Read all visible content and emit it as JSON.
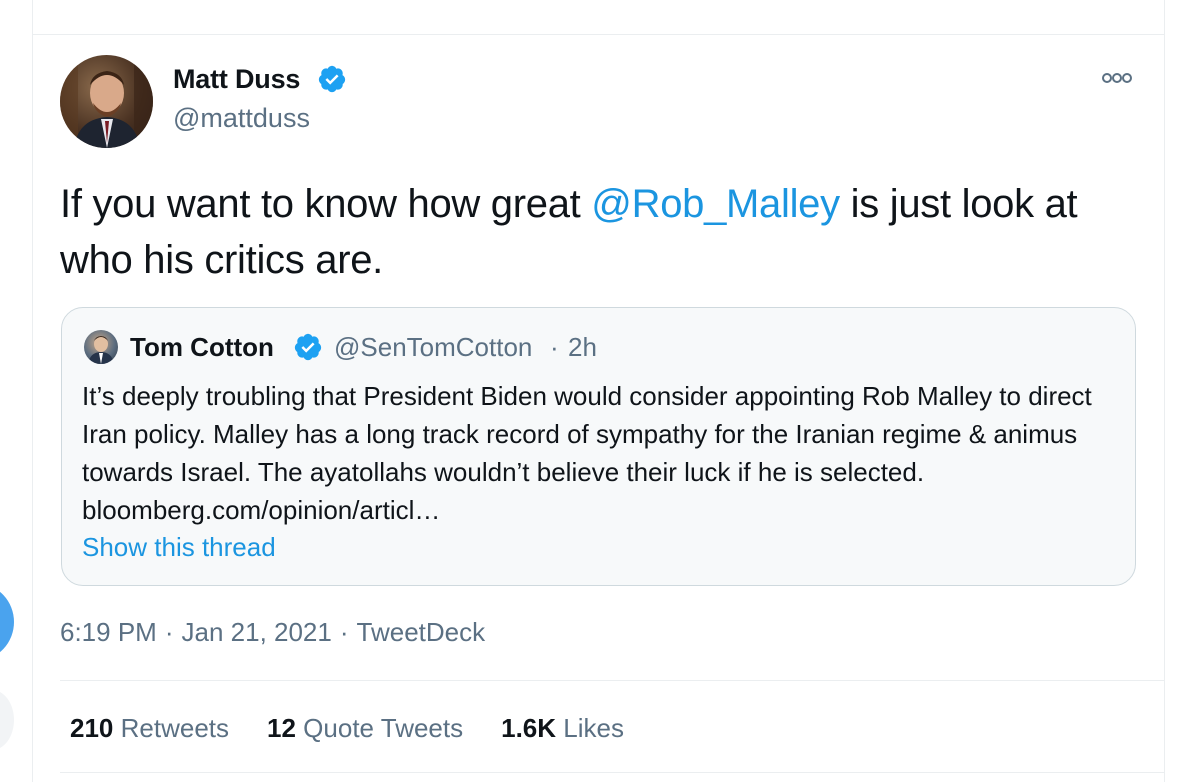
{
  "tweet": {
    "author": {
      "display_name": "Matt Duss",
      "handle": "@mattduss",
      "verified": true
    },
    "text_before": "If you want to know how great ",
    "mention": "@Rob_Malley",
    "text_after": " is just look at who his critics are.",
    "more_icon": "more-horizontal-icon",
    "quoted": {
      "author": {
        "display_name": "Tom Cotton",
        "handle": "@SenTomCotton",
        "verified": true
      },
      "separator": "·",
      "time": "2h",
      "text": "It’s deeply troubling that President Biden would consider appointing Rob Malley to direct Iran policy. Malley has a long track record of sympathy for the Iranian regime & animus towards Israel. The ayatollahs wouldn’t believe their luck if he is selected. bloomberg.com/opinion/articl…",
      "show_thread": "Show this thread"
    },
    "meta": {
      "time": "6:19 PM",
      "separator": "·",
      "date": "Jan 21, 2021",
      "source": "TweetDeck"
    },
    "stats": {
      "retweets_count": "210",
      "retweets_label": "Retweets",
      "quotes_count": "12",
      "quotes_label": "Quote Tweets",
      "likes_count": "1.6K",
      "likes_label": "Likes"
    }
  },
  "colors": {
    "link": "#1b95e0",
    "secondary_text": "#5b7083",
    "primary_text": "#0f1419",
    "border": "#cfd9de",
    "verified": "#1da1f2"
  }
}
